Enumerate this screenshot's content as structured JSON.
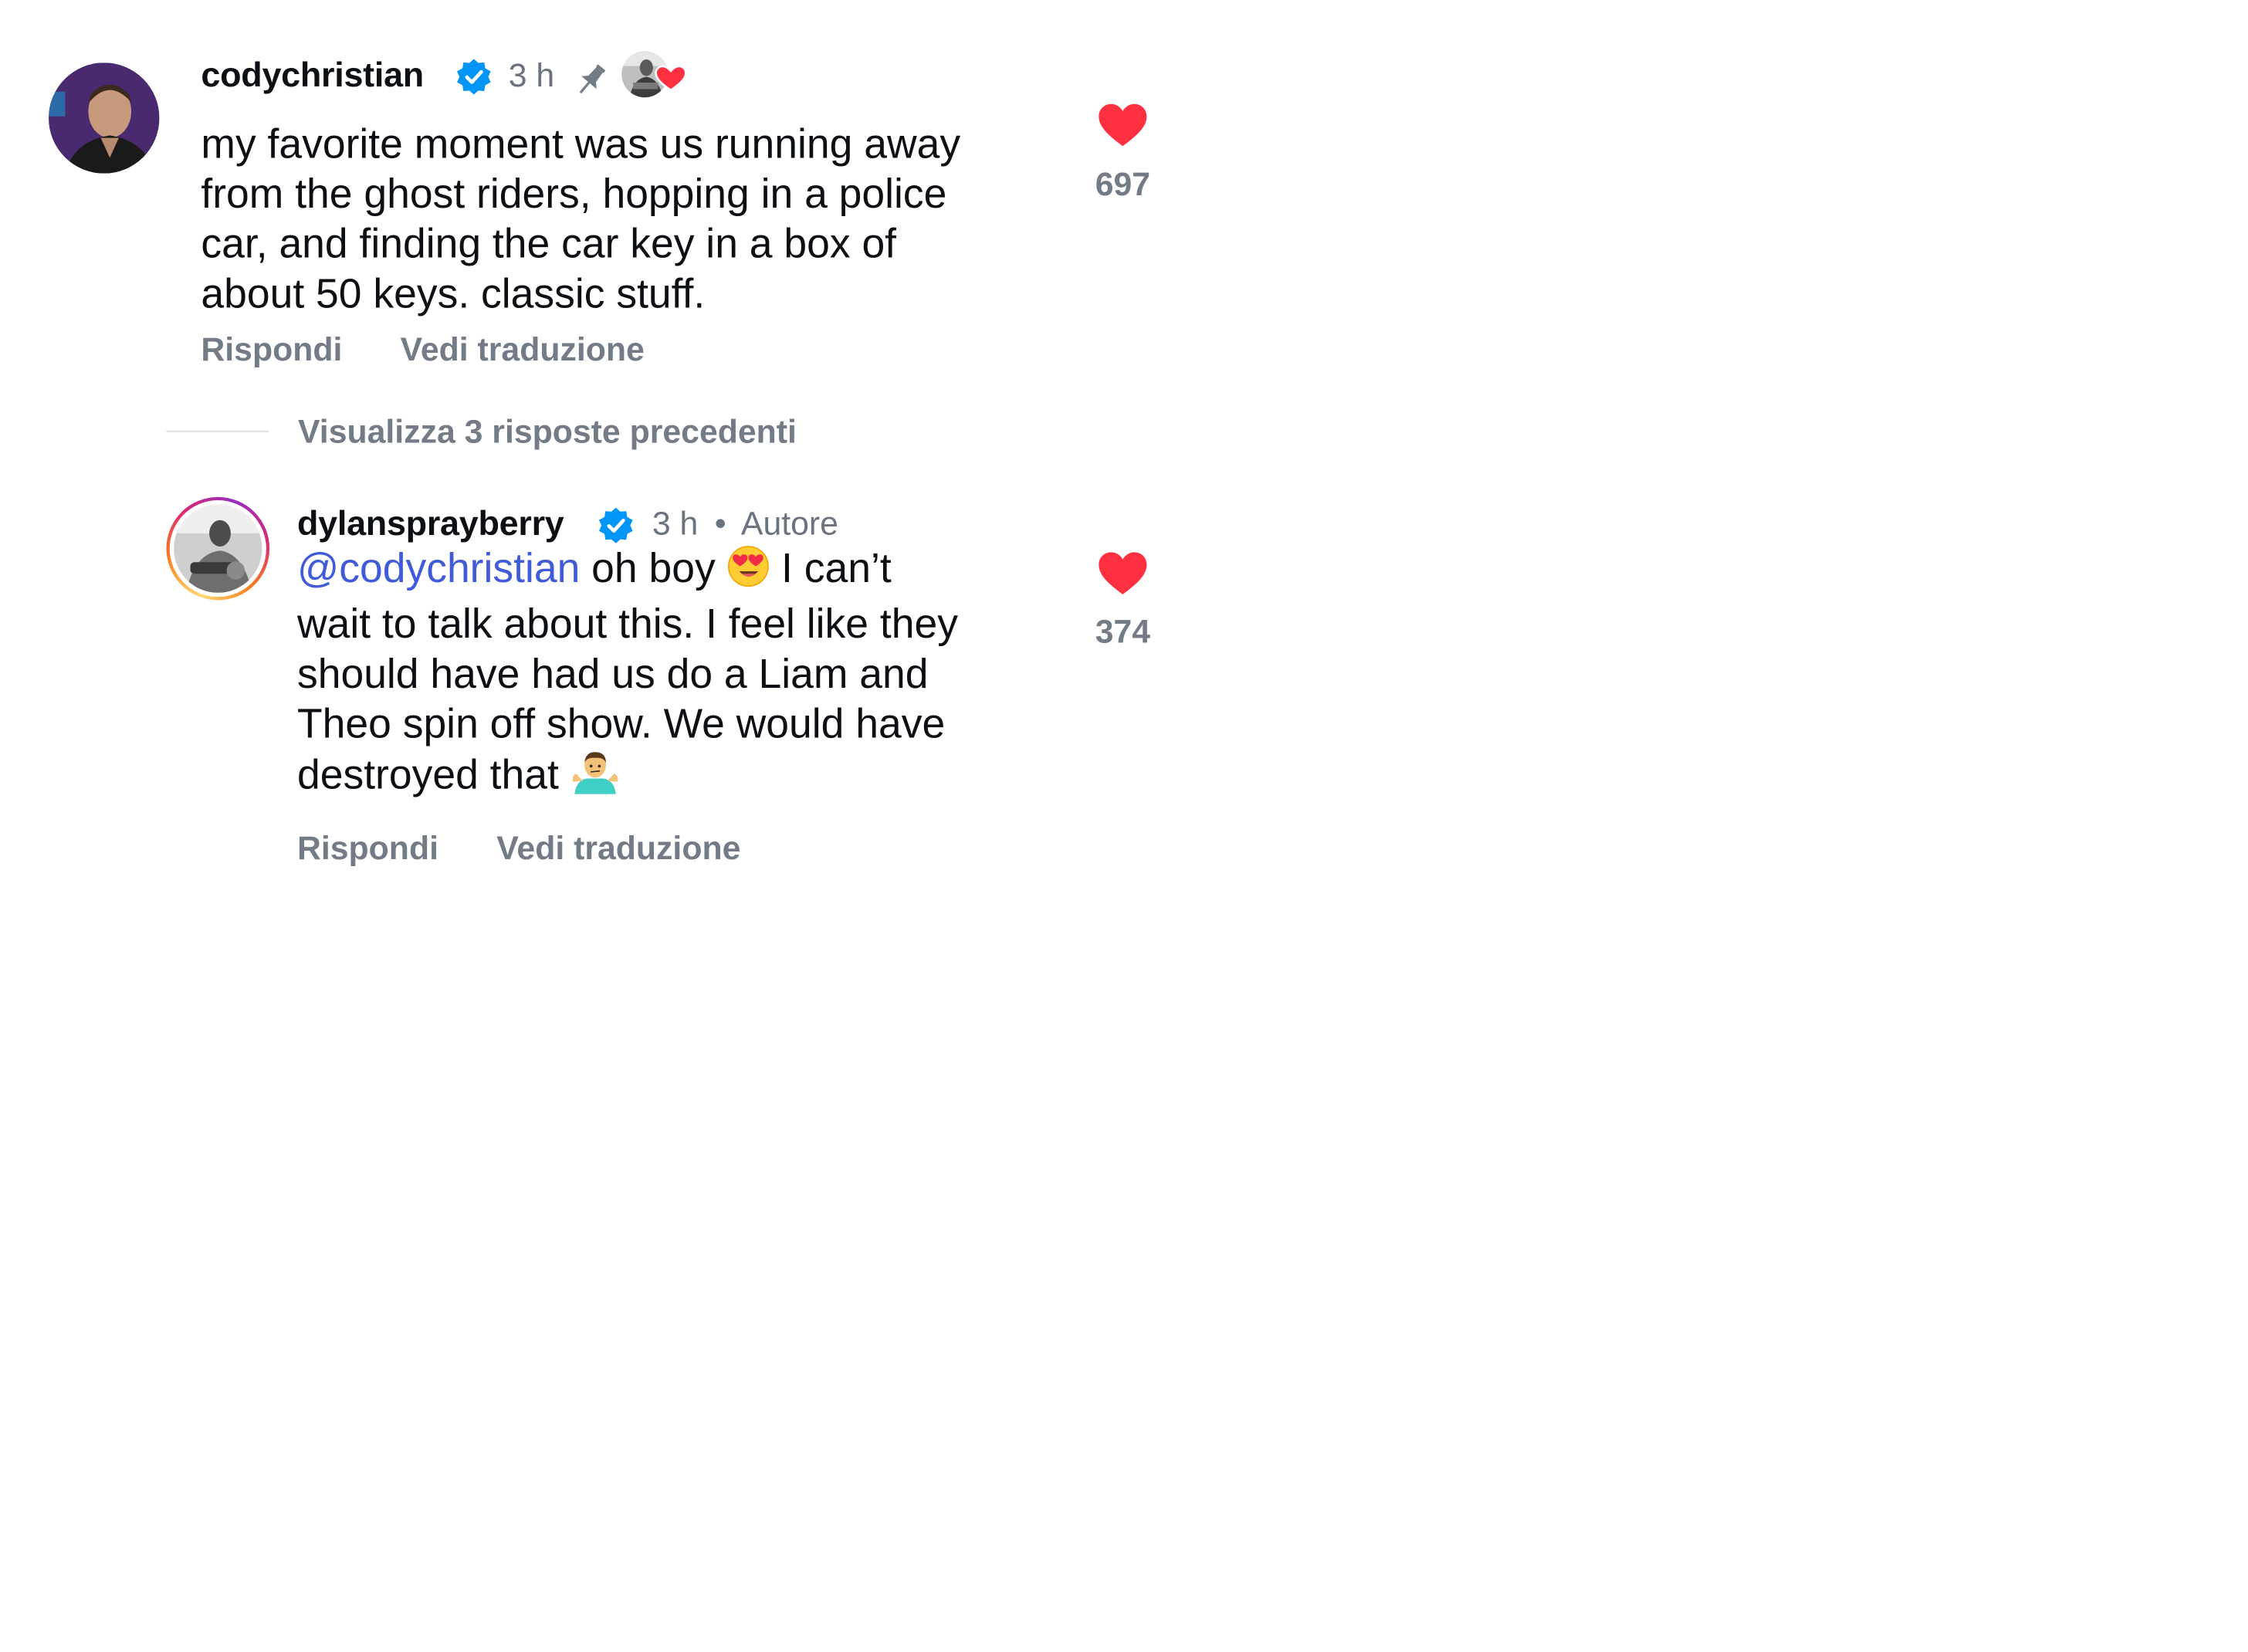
{
  "comments": [
    {
      "username": "codychristian",
      "time": "3 h",
      "lines": [
        "my favorite moment was us running away",
        "from the ghost riders, hopping in a police",
        "car, and finding the car key in a box of",
        "about 50 keys. classic stuff."
      ],
      "reply_label": "Rispondi",
      "translate_label": "Vedi traduzione",
      "likes": "697",
      "icons": [
        "verified-badge-icon",
        "pin-icon",
        "liked-by-author-icon",
        "heart-icon"
      ]
    },
    {
      "username": "dylansprayberry",
      "time": "3 h",
      "separator": "•",
      "author_label": "Autore",
      "mention": "@codychristian",
      "line1_rest": " oh boy ",
      "line1_after_emoji": " I can’t",
      "lines_rest": [
        "wait to talk about this. I feel like they",
        "should have had us do a Liam and",
        "Theo spin off show. We would have"
      ],
      "last_line": "destroyed that ",
      "reply_label": "Rispondi",
      "translate_label": "Vedi traduzione",
      "likes": "374",
      "icons": [
        "verified-badge-icon",
        "heart-eyes-emoji-icon",
        "shrug-emoji-icon",
        "heart-icon"
      ]
    }
  ],
  "view_replies_label": "Visualizza 3 risposte precedenti",
  "colors": {
    "heart": "#ff3040",
    "verified": "#0095f6",
    "mention": "#3f5bd8",
    "secondary_text": "#737b86"
  }
}
